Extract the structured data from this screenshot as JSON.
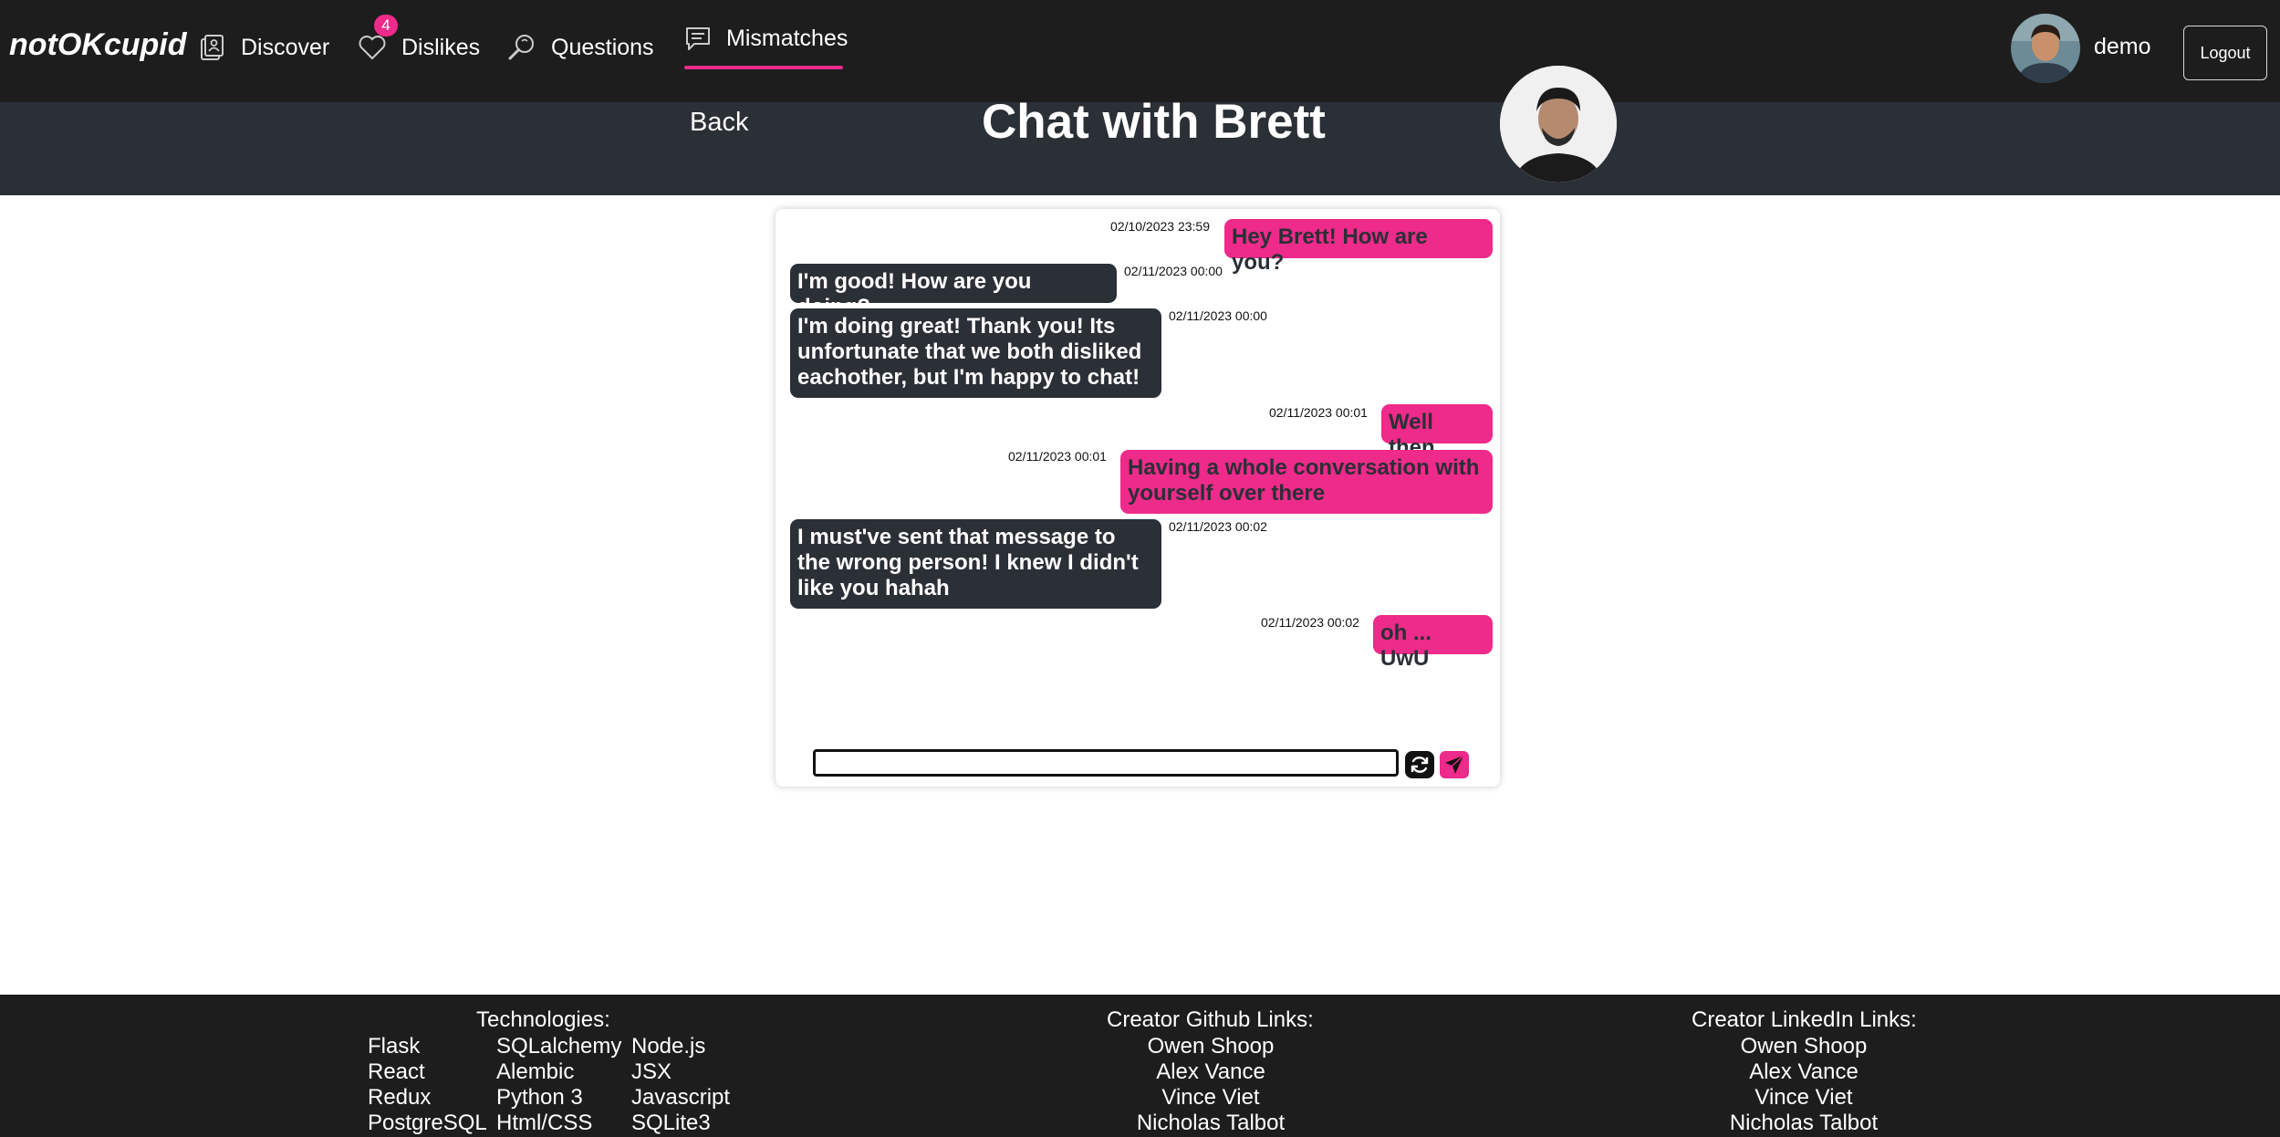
{
  "nav": {
    "brand": "notOKcupid",
    "items": [
      {
        "label": "Discover",
        "icon": "discover-icon"
      },
      {
        "label": "Dislikes",
        "icon": "heart-icon",
        "badge": "4"
      },
      {
        "label": "Questions",
        "icon": "magnifier-icon"
      },
      {
        "label": "Mismatches",
        "icon": "chat-icon",
        "active": true
      }
    ],
    "username": "demo",
    "logout": "Logout"
  },
  "chat": {
    "back": "Back",
    "title": "Chat with Brett",
    "messages": [
      {
        "from": "me",
        "text": "Hey Brett! How are you?",
        "time": "02/10/2023 23:59"
      },
      {
        "from": "them",
        "text": "I'm good! How are you doing?",
        "time": "02/11/2023 00:00"
      },
      {
        "from": "them",
        "text": "I'm doing great! Thank you! Its unfortunate that we both disliked eachother, but I'm happy to chat!",
        "time": "02/11/2023 00:00"
      },
      {
        "from": "me",
        "text": "Well then",
        "time": "02/11/2023 00:01"
      },
      {
        "from": "me",
        "text": "Having a whole conversation with yourself over there",
        "time": "02/11/2023 00:01"
      },
      {
        "from": "them",
        "text": "I must've sent that message to the wrong person! I knew I didn't like you hahah",
        "time": "02/11/2023 00:02"
      },
      {
        "from": "me",
        "text": "oh ... UwU",
        "time": "02/11/2023 00:02"
      }
    ],
    "input_value": ""
  },
  "footer": {
    "technologies": {
      "title": "Technologies:",
      "col1": [
        "Flask",
        "React",
        "Redux",
        "PostgreSQL"
      ],
      "col2": [
        "SQLalchemy",
        "Alembic",
        "Python 3",
        "Html/CSS"
      ],
      "col3": [
        "Node.js",
        "JSX",
        "Javascript",
        "SQLite3"
      ]
    },
    "github": {
      "title": "Creator Github Links:",
      "names": [
        "Owen Shoop",
        "Alex Vance",
        "Vince Viet",
        "Nicholas Talbot"
      ]
    },
    "linkedin": {
      "title": "Creator LinkedIn Links:",
      "names": [
        "Owen Shoop",
        "Alex Vance",
        "Vince Viet",
        "Nicholas Talbot"
      ]
    }
  },
  "colors": {
    "accent": "#ee2a8a",
    "nav_bg": "#1d1d1d",
    "header_bg": "#2b2f36",
    "their_bubble": "#2b2f36"
  }
}
